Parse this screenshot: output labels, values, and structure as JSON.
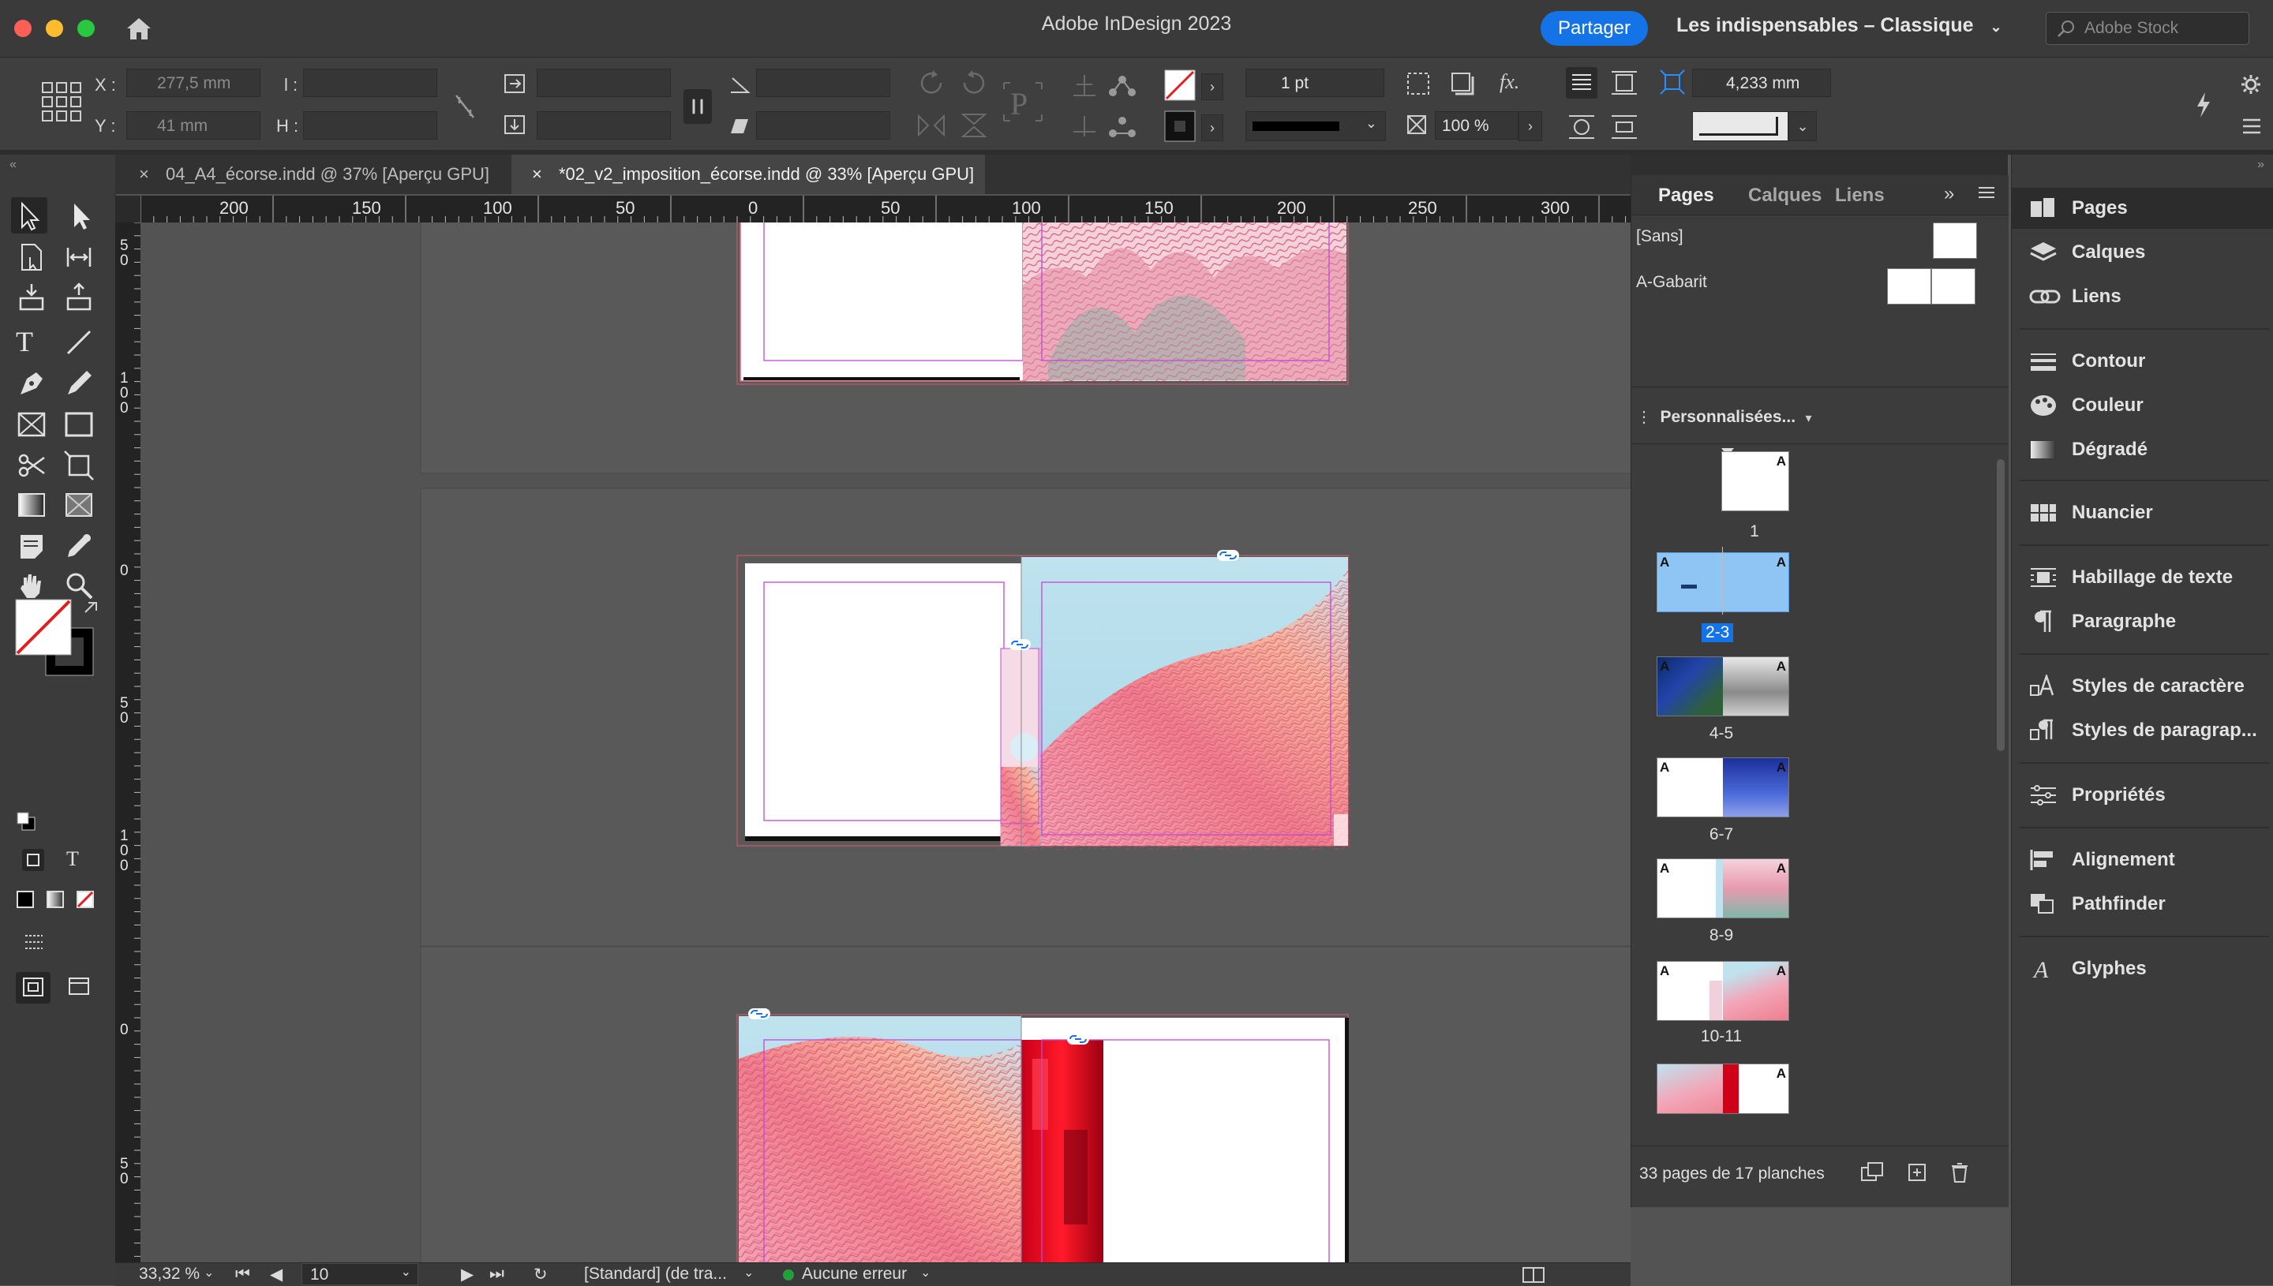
{
  "window": {
    "title": "Adobe InDesign 2023",
    "share_label": "Partager",
    "workspace": "Les indispensables – Classique",
    "stock_placeholder": "Adobe Stock"
  },
  "control": {
    "x_label": "X :",
    "y_label": "Y :",
    "w_label": "l :",
    "h_label": "H :",
    "x_value": "277,5 mm",
    "y_value": "41 mm",
    "stroke_weight": "1 pt",
    "opacity": "100 %",
    "offset_value": "4,233 mm",
    "fx_label": "fx."
  },
  "tabs": [
    {
      "label": "04_A4_écorse.indd @ 37% [Aperçu GPU]",
      "active": false
    },
    {
      "label": "*02_v2_imposition_écorse.indd @ 33% [Aperçu GPU]",
      "active": true
    }
  ],
  "ruler": {
    "h_ticks": [
      "200",
      "150",
      "100",
      "50",
      "0",
      "50",
      "100",
      "150",
      "200",
      "250",
      "300"
    ],
    "v_ticks": [
      "5\n0",
      "1\n0\n0",
      "0",
      "5\n0",
      "1\n0\n0",
      "0",
      "5\n0"
    ]
  },
  "pages_panel": {
    "tabs": [
      "Pages",
      "Calques",
      "Liens"
    ],
    "master_none": "[Sans]",
    "master_a": "A-Gabarit",
    "size_menu": "Personnalisées...",
    "spreads": [
      {
        "label": "1",
        "selected": false
      },
      {
        "label": "2-3",
        "selected": true
      },
      {
        "label": "4-5",
        "selected": false
      },
      {
        "label": "6-7",
        "selected": false
      },
      {
        "label": "8-9",
        "selected": false
      },
      {
        "label": "10-11",
        "selected": false
      }
    ],
    "master_marker": "A",
    "footer": "33 pages de 17 planches"
  },
  "dock": {
    "items": [
      "Pages",
      "Calques",
      "Liens",
      "Contour",
      "Couleur",
      "Dégradé",
      "Nuancier",
      "Habillage de texte",
      "Paragraphe",
      "Styles de caractère",
      "Styles de paragrap...",
      "Propriétés",
      "Alignement",
      "Pathfinder",
      "Glyphes"
    ]
  },
  "status": {
    "zoom": "33,32 %",
    "page": "10",
    "profile": "[Standard] (de tra...",
    "preflight": "Aucune erreur"
  },
  "colors": {
    "accent": "#1473e6",
    "selection_blue": "#8ec5f5",
    "preflight_ok": "#23a03c"
  }
}
